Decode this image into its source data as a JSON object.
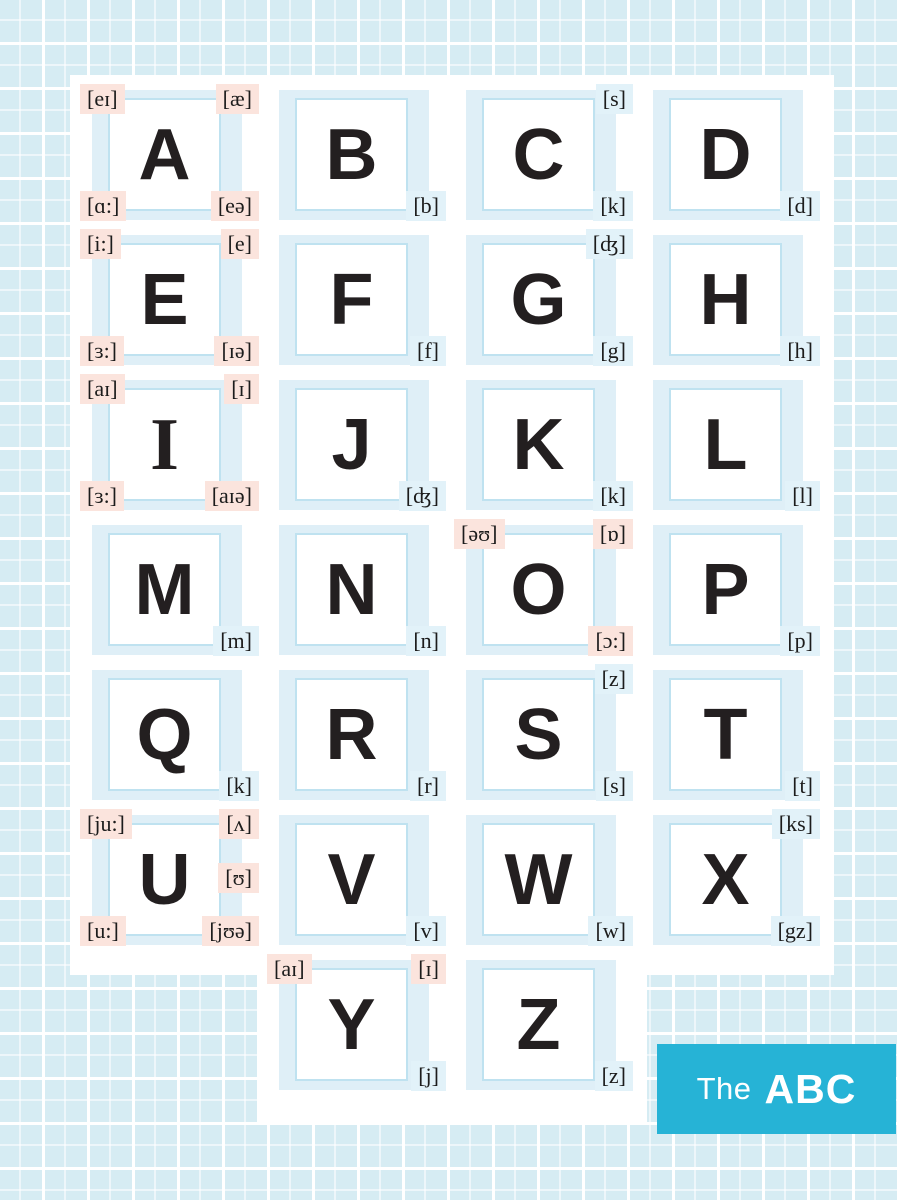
{
  "background": {
    "grid_color": "#d6ecf3",
    "grid_line_color": "#ffffff"
  },
  "colors": {
    "vowel_tag_bg": "#fbe4dd",
    "consonant_tag_bg": "#e2f2f9",
    "tile_bg": "#bfe2f0",
    "card_border": "#bfe2f0",
    "letter": "#231f20",
    "logo_bg": "#26b3d6",
    "logo_text": "#ffffff"
  },
  "logo": {
    "word_light": "The",
    "word_bold": "ABC"
  },
  "grid": {
    "columns": 4,
    "rows": 7,
    "cells": [
      {
        "letter": "A",
        "type": "vowel",
        "serif": false,
        "tags": [
          {
            "text": "[eɪ]",
            "pos": "tl",
            "style": "pink"
          },
          {
            "text": "[æ]",
            "pos": "tr",
            "style": "pink"
          },
          {
            "text": "[ɑ:]",
            "pos": "bl",
            "style": "pink"
          },
          {
            "text": "[eə]",
            "pos": "br",
            "style": "pink"
          }
        ]
      },
      {
        "letter": "B",
        "type": "consonant",
        "serif": false,
        "tags": [
          {
            "text": "[b]",
            "pos": "br",
            "style": "blue"
          }
        ]
      },
      {
        "letter": "C",
        "type": "consonant",
        "serif": false,
        "tags": [
          {
            "text": "[s]",
            "pos": "tr",
            "style": "blue"
          },
          {
            "text": "[k]",
            "pos": "br",
            "style": "blue"
          }
        ]
      },
      {
        "letter": "D",
        "type": "consonant",
        "serif": false,
        "tags": [
          {
            "text": "[d]",
            "pos": "br",
            "style": "blue"
          }
        ]
      },
      {
        "letter": "E",
        "type": "vowel",
        "serif": false,
        "tags": [
          {
            "text": "[i:]",
            "pos": "tl",
            "style": "pink"
          },
          {
            "text": "[e]",
            "pos": "tr",
            "style": "pink"
          },
          {
            "text": "[ɜ:]",
            "pos": "bl",
            "style": "pink"
          },
          {
            "text": "[ɪə]",
            "pos": "br",
            "style": "pink"
          }
        ]
      },
      {
        "letter": "F",
        "type": "consonant",
        "serif": false,
        "tags": [
          {
            "text": "[f]",
            "pos": "br",
            "style": "blue"
          }
        ]
      },
      {
        "letter": "G",
        "type": "consonant",
        "serif": false,
        "tags": [
          {
            "text": "[ʤ]",
            "pos": "tr",
            "style": "blue"
          },
          {
            "text": "[g]",
            "pos": "br",
            "style": "blue"
          }
        ]
      },
      {
        "letter": "H",
        "type": "consonant",
        "serif": false,
        "tags": [
          {
            "text": "[h]",
            "pos": "br",
            "style": "blue"
          }
        ]
      },
      {
        "letter": "I",
        "type": "vowel",
        "serif": true,
        "tags": [
          {
            "text": "[aɪ]",
            "pos": "tl",
            "style": "pink"
          },
          {
            "text": "[ɪ]",
            "pos": "tr",
            "style": "pink"
          },
          {
            "text": "[ɜ:]",
            "pos": "bl",
            "style": "pink"
          },
          {
            "text": "[aɪə]",
            "pos": "br",
            "style": "pink"
          }
        ]
      },
      {
        "letter": "J",
        "type": "consonant",
        "serif": false,
        "tags": [
          {
            "text": "[ʤ]",
            "pos": "br",
            "style": "blue"
          }
        ]
      },
      {
        "letter": "K",
        "type": "consonant",
        "serif": false,
        "tags": [
          {
            "text": "[k]",
            "pos": "br",
            "style": "blue"
          }
        ]
      },
      {
        "letter": "L",
        "type": "consonant",
        "serif": false,
        "tags": [
          {
            "text": "[l]",
            "pos": "br",
            "style": "blue"
          }
        ]
      },
      {
        "letter": "M",
        "type": "consonant",
        "serif": false,
        "tags": [
          {
            "text": "[m]",
            "pos": "br",
            "style": "blue"
          }
        ]
      },
      {
        "letter": "N",
        "type": "consonant",
        "serif": false,
        "tags": [
          {
            "text": "[n]",
            "pos": "br",
            "style": "blue"
          }
        ]
      },
      {
        "letter": "O",
        "type": "vowel",
        "serif": false,
        "tags": [
          {
            "text": "[əʊ]",
            "pos": "tl",
            "style": "pink"
          },
          {
            "text": "[ɒ]",
            "pos": "tr",
            "style": "pink"
          },
          {
            "text": "[ɔ:]",
            "pos": "br",
            "style": "pink"
          }
        ]
      },
      {
        "letter": "P",
        "type": "consonant",
        "serif": false,
        "tags": [
          {
            "text": "[p]",
            "pos": "br",
            "style": "blue"
          }
        ]
      },
      {
        "letter": "Q",
        "type": "consonant",
        "serif": false,
        "tags": [
          {
            "text": "[k]",
            "pos": "br",
            "style": "blue"
          }
        ]
      },
      {
        "letter": "R",
        "type": "consonant",
        "serif": false,
        "tags": [
          {
            "text": "[r]",
            "pos": "br",
            "style": "blue"
          }
        ]
      },
      {
        "letter": "S",
        "type": "consonant",
        "serif": false,
        "tags": [
          {
            "text": "[z]",
            "pos": "tr",
            "style": "blue"
          },
          {
            "text": "[s]",
            "pos": "br",
            "style": "blue"
          }
        ]
      },
      {
        "letter": "T",
        "type": "consonant",
        "serif": false,
        "tags": [
          {
            "text": "[t]",
            "pos": "br",
            "style": "blue"
          }
        ]
      },
      {
        "letter": "U",
        "type": "vowel",
        "serif": false,
        "tags": [
          {
            "text": "[ju:]",
            "pos": "tl",
            "style": "pink"
          },
          {
            "text": "[ʌ]",
            "pos": "tr",
            "style": "pink"
          },
          {
            "text": "[ʊ]",
            "pos": "mr",
            "style": "pink"
          },
          {
            "text": "[u:]",
            "pos": "bl",
            "style": "pink"
          },
          {
            "text": "[jʊə]",
            "pos": "br",
            "style": "pink"
          }
        ]
      },
      {
        "letter": "V",
        "type": "consonant",
        "serif": false,
        "tags": [
          {
            "text": "[v]",
            "pos": "br",
            "style": "blue"
          }
        ]
      },
      {
        "letter": "W",
        "type": "consonant",
        "serif": false,
        "tags": [
          {
            "text": "[w]",
            "pos": "br",
            "style": "blue"
          }
        ]
      },
      {
        "letter": "X",
        "type": "consonant",
        "serif": false,
        "tags": [
          {
            "text": "[ks]",
            "pos": "tr",
            "style": "blue"
          },
          {
            "text": "[gz]",
            "pos": "br",
            "style": "blue"
          }
        ]
      },
      {
        "letter": "",
        "type": "empty",
        "serif": false,
        "tags": []
      },
      {
        "letter": "Y",
        "type": "vowel",
        "serif": false,
        "tags": [
          {
            "text": "[aɪ]",
            "pos": "tl",
            "style": "pink"
          },
          {
            "text": "[ɪ]",
            "pos": "tr",
            "style": "pink"
          },
          {
            "text": "[j]",
            "pos": "br",
            "style": "blue"
          }
        ]
      },
      {
        "letter": "Z",
        "type": "consonant",
        "serif": false,
        "tags": [
          {
            "text": "[z]",
            "pos": "br",
            "style": "blue"
          }
        ]
      },
      {
        "letter": "",
        "type": "empty",
        "serif": false,
        "tags": []
      }
    ]
  }
}
